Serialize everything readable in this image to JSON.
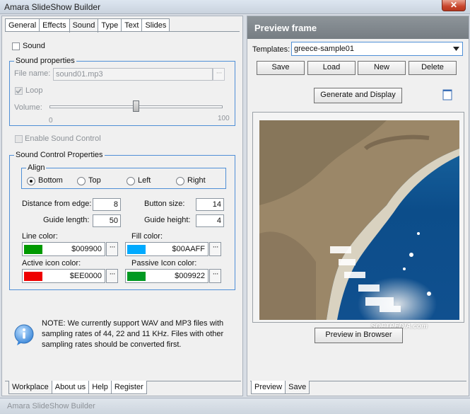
{
  "window": {
    "title": "Amara SlideShow Builder",
    "close_glyph": "✕"
  },
  "tabs": [
    "General",
    "Effects",
    "Sound",
    "Type",
    "Text",
    "Slides"
  ],
  "sound_checkbox": "Sound",
  "sound_properties": {
    "title": "Sound properties",
    "file_name_label": "File name:",
    "file_name_value": "sound01.mp3",
    "browse": "···",
    "loop_label": "Loop",
    "volume_label": "Volume:",
    "volume_min": "0",
    "volume_max": "100",
    "volume_level": 0.5
  },
  "enable_sound_control": "Enable Sound Control",
  "sound_control_properties": {
    "title": "Sound Control  Properties",
    "align_title": "Align",
    "align_options": [
      "Bottom",
      "Top",
      "Left",
      "Right"
    ],
    "align_selected": "Bottom",
    "distance_label": "Distance from edge:",
    "distance_value": "8",
    "button_size_label": "Button size:",
    "button_size_value": "14",
    "guide_length_label": "Guide length:",
    "guide_length_value": "50",
    "guide_height_label": "Guide height:",
    "guide_height_value": "4",
    "line_color_label": "Line color:",
    "line_color_value": "$009900",
    "line_color_hex": "#009900",
    "fill_color_label": "Fill color:",
    "fill_color_value": "$00AAFF",
    "fill_color_hex": "#00AAFF",
    "active_icon_label": "Active icon color:",
    "active_icon_value": "$EE0000",
    "active_icon_hex": "#EE0000",
    "passive_icon_label": "Passive Icon color:",
    "passive_icon_value": "$009922",
    "passive_icon_hex": "#009922",
    "dots": "···"
  },
  "note": {
    "icon": "info-icon",
    "line1": "NOTE: We currently support WAV and MP3 files with",
    "line2": "sampling rates of 44, 22 and 11 KHz. Files with other",
    "line3": "sampling rates should be converted first."
  },
  "bottom_tabs_left": [
    "Workplace",
    "About us",
    "Help",
    "Register"
  ],
  "preview": {
    "title": "Preview frame",
    "templates_label": "Templates:",
    "templates_value": "greece-sample01",
    "buttons": [
      "Save",
      "Load",
      "New",
      "Delete"
    ],
    "generate_button": "Generate and Display",
    "preview_browser_button": "Preview in Browser",
    "watermark": "SOFTPEDIA.com"
  },
  "bottom_tabs_right": [
    "Preview",
    "Save"
  ],
  "status_text": "Amara SlideShow Builder"
}
